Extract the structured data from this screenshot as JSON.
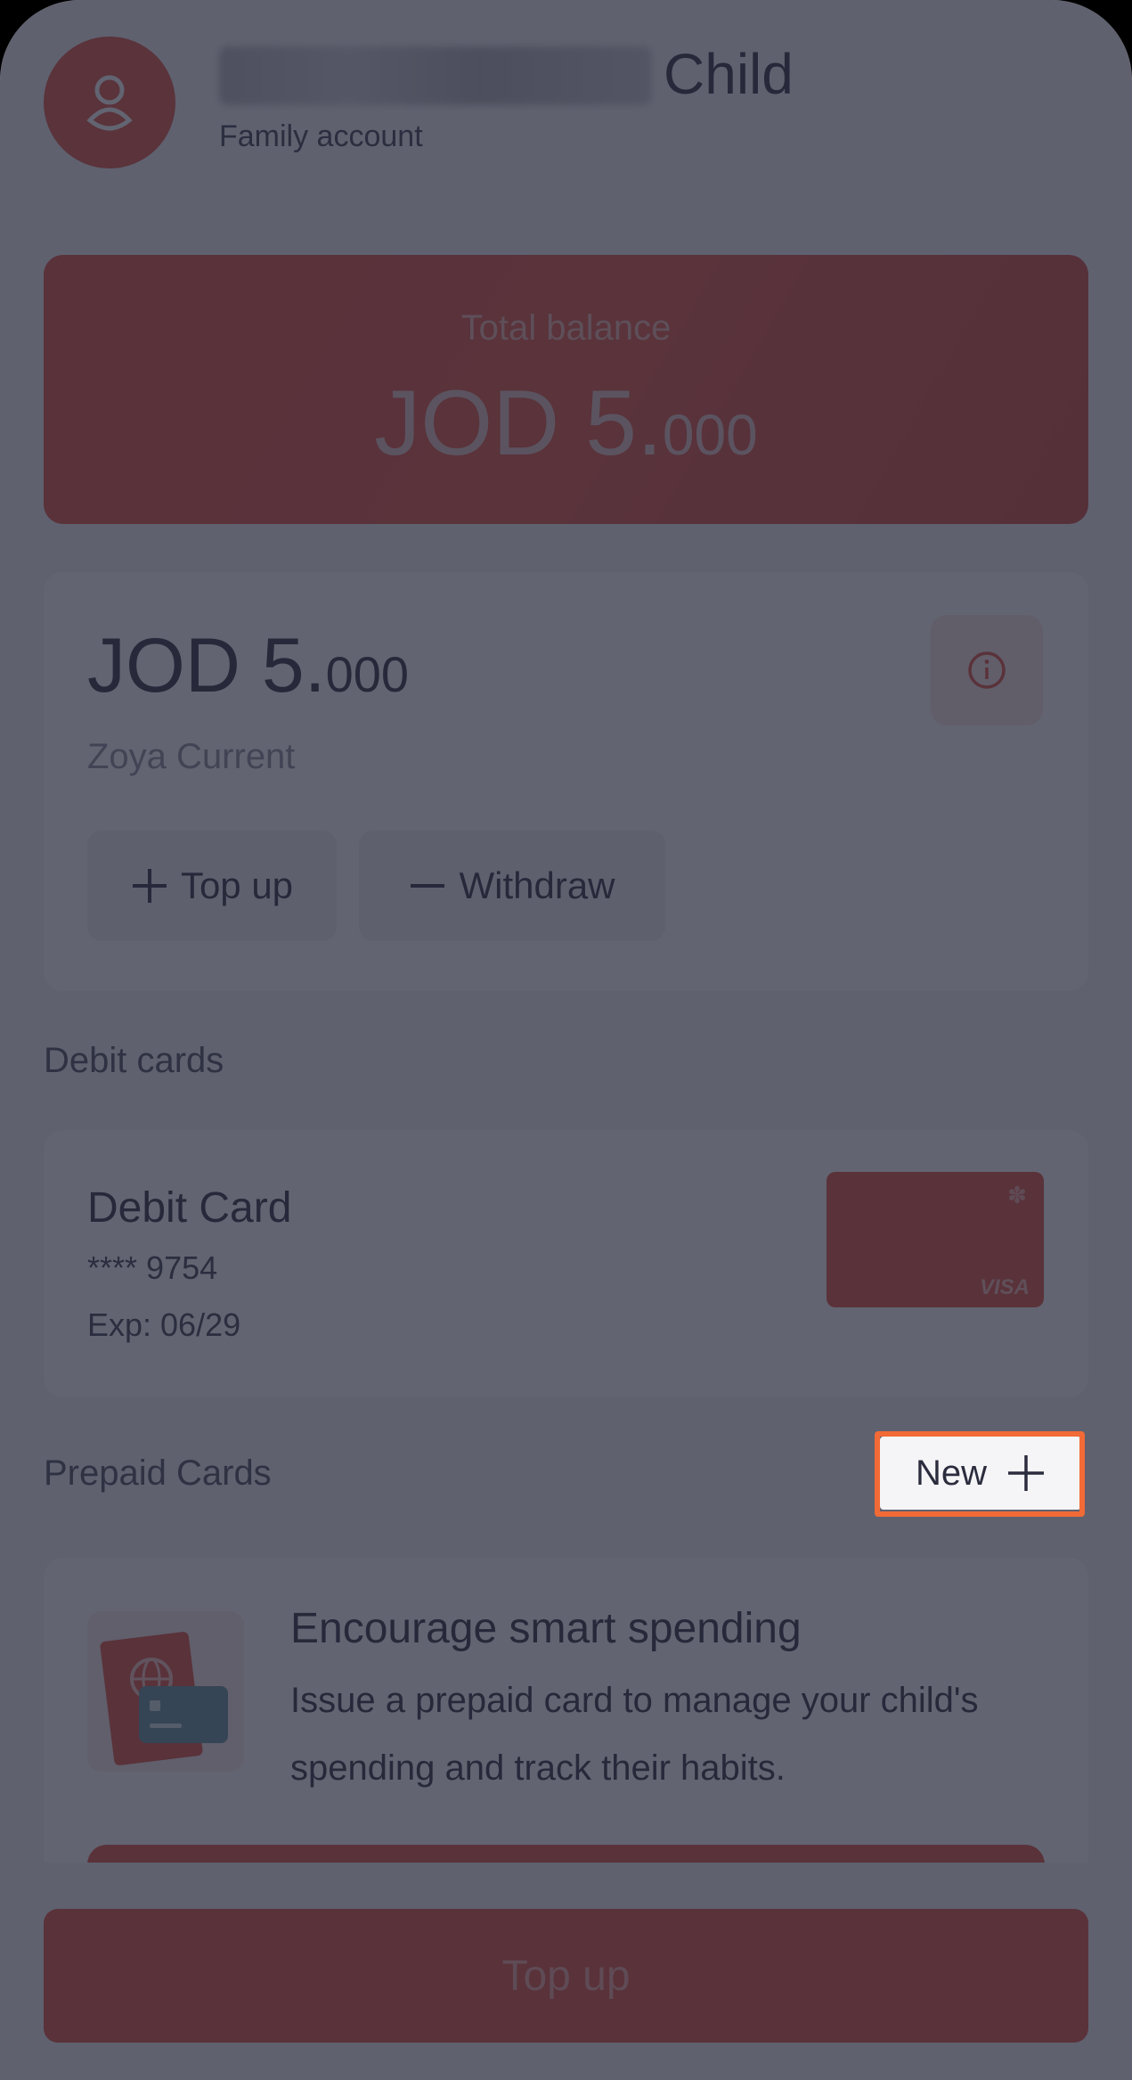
{
  "header": {
    "title_suffix": "Child",
    "subtitle": "Family account"
  },
  "total_balance": {
    "label": "Total balance",
    "currency_int": "JOD 5.",
    "decimals": "000"
  },
  "account": {
    "amount_int": "JOD 5.",
    "amount_dec": "000",
    "name": "Zoya Current",
    "topup_label": "Top up",
    "withdraw_label": "Withdraw"
  },
  "debit": {
    "heading": "Debit cards",
    "title": "Debit Card",
    "number": "**** 9754",
    "expiry": "Exp: 06/29",
    "brand": "VISA"
  },
  "prepaid": {
    "heading": "Prepaid Cards",
    "new_label": "New",
    "title": "Encourage smart spending",
    "description": "Issue a prepaid card to manage your child's spending and track their habits."
  },
  "footer": {
    "topup_label": "Top up"
  },
  "colors": {
    "accent": "#e24b3a",
    "highlight": "#f26a36",
    "overlay": "#26283a"
  },
  "icons": [
    "user-icon",
    "info-icon",
    "plus-icon",
    "minus-icon",
    "gear-icon",
    "globe-icon"
  ]
}
